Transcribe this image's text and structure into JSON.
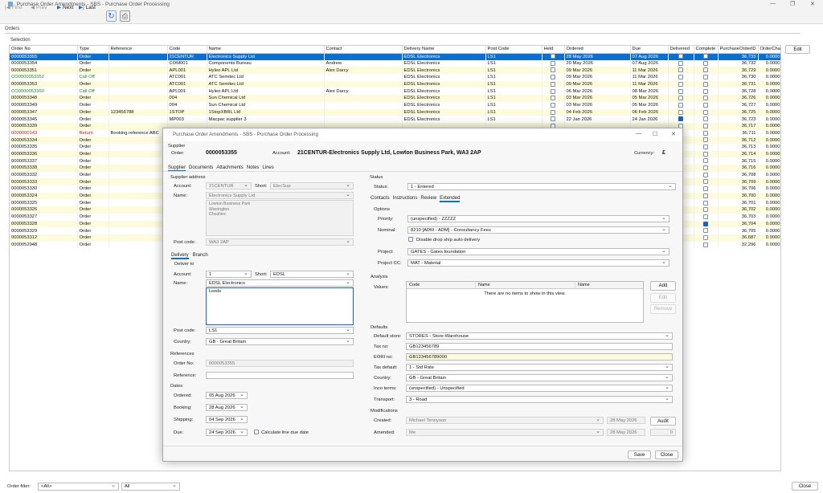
{
  "window": {
    "title": "Purchase Order Amendments - SBS - Purchase Order Processing"
  },
  "toolbar": {
    "first": "First",
    "prev": "Prev",
    "next": "Next",
    "last": "Last"
  },
  "sections": {
    "orders": "Orders",
    "selection": "Selection"
  },
  "grid": {
    "columns": [
      "Order No",
      "Type",
      "Reference",
      "Code",
      "Name",
      "Contact",
      "Delivery Name",
      "Post Code",
      "Held",
      "Ordered",
      "Due",
      "Delivered",
      "Complete",
      "PurchaseOrderID",
      "OrderCha"
    ],
    "rows": [
      {
        "no": "0000053355",
        "type": "Order",
        "ref": "",
        "code": "21CENTUR",
        "name": "Electronics Supply Ltd",
        "contact": "",
        "deliv": "EDSL Electronics",
        "pc": "LS1",
        "ordered": "28 May 2026",
        "due": "07 Aug 2026",
        "delivered": false,
        "complete": false,
        "id": "36,733",
        "cha": "0.0000",
        "style": "sel"
      },
      {
        "no": "0000053354",
        "type": "Order",
        "ref": "",
        "code": "COM001",
        "name": "Components Bureau",
        "contact": "Andrew",
        "deliv": "EDSL Electronics",
        "pc": "LS1",
        "ordered": "20 May 2026",
        "due": "07 Aug 2026",
        "delivered": false,
        "complete": false,
        "id": "36,732",
        "cha": "0.0000",
        "style": ""
      },
      {
        "no": "0000053351",
        "type": "Order",
        "ref": "",
        "code": "APL001",
        "name": "Hyleo APL Ltd",
        "contact": "Alex Darcy",
        "deliv": "EDSL Electronics",
        "pc": "LS1",
        "ordered": "09 Mar 2026",
        "due": "11 Mar 2026",
        "delivered": false,
        "complete": false,
        "id": "36,729",
        "cha": "0.0000",
        "style": "alt"
      },
      {
        "no": "CO0000053352",
        "type": "Call Off",
        "ref": "",
        "code": "ATC001",
        "name": "ATC Semitec Ltd",
        "contact": "",
        "deliv": "EDSL Electronics",
        "pc": "LS1",
        "ordered": "09 Mar 2026",
        "due": "11 Mar 2026",
        "delivered": false,
        "complete": false,
        "id": "36,730",
        "cha": "0.0000",
        "style": "green"
      },
      {
        "no": "0000053353",
        "type": "Order",
        "ref": "",
        "code": "ATC001",
        "name": "ATC Semitec Ltd",
        "contact": "",
        "deliv": "EDSL Electronics",
        "pc": "LS1",
        "ordered": "09 Mar 2026",
        "due": "11 Mar 2026",
        "delivered": false,
        "complete": false,
        "id": "36,731",
        "cha": "0.0000",
        "style": "alt"
      },
      {
        "no": "CO0000053350",
        "type": "Call Off",
        "ref": "",
        "code": "APL001",
        "name": "Hyleo APL Ltd",
        "contact": "Alex Darcy",
        "deliv": "EDSL Electronics",
        "pc": "LS1",
        "ordered": "06 Mar 2026",
        "due": "08 Mar 2026",
        "delivered": false,
        "complete": false,
        "id": "36,728",
        "cha": "0.0000",
        "style": "green"
      },
      {
        "no": "0000053348",
        "type": "Order",
        "ref": "",
        "code": "004",
        "name": "Sun Chemical Ltd",
        "contact": "",
        "deliv": "EDSL Electronics",
        "pc": "LS1",
        "ordered": "03 Mar 2026",
        "due": "05 Mar 2026",
        "delivered": false,
        "complete": false,
        "id": "36,726",
        "cha": "0.0000",
        "style": "alt"
      },
      {
        "no": "0000053349",
        "type": "Order",
        "ref": "",
        "code": "004",
        "name": "Sun Chemical Ltd",
        "contact": "",
        "deliv": "EDSL Electronics",
        "pc": "LS1",
        "ordered": "03 Mar 2026",
        "due": "05 Mar 2026",
        "delivered": false,
        "complete": false,
        "id": "36,727",
        "cha": "0.0000",
        "style": ""
      },
      {
        "no": "0000053347",
        "type": "Order",
        "ref": "123456788",
        "code": "1STOP",
        "name": "1StopXBRL Ltd",
        "contact": "",
        "deliv": "EDSL Electronics",
        "pc": "LS1",
        "ordered": "04 Feb 2026",
        "due": "06 Feb 2026",
        "delivered": false,
        "complete": false,
        "id": "36,725",
        "cha": "0.0000",
        "style": "alt"
      },
      {
        "no": "0000053345",
        "type": "Order",
        "ref": "",
        "code": "MP003",
        "name": "Macpac supplier 3",
        "contact": "",
        "deliv": "EDSL Electronics",
        "pc": "LS1",
        "ordered": "22 Jan 2026",
        "due": "24 Jan 2026",
        "delivered": true,
        "complete": false,
        "id": "36,723",
        "cha": "0.0000",
        "style": ""
      },
      {
        "no": "0000053339",
        "type": "Order",
        "ref": "",
        "code": "",
        "name": "",
        "contact": "",
        "deliv": "",
        "pc": "",
        "ordered": "",
        "due": "",
        "delivered": false,
        "complete": false,
        "id": "36,717",
        "cha": "0.0000",
        "style": "alt"
      },
      {
        "no": "0000000143",
        "type": "Return",
        "ref": "Booking reference ABC",
        "code": "",
        "name": "",
        "contact": "",
        "deliv": "",
        "pc": "",
        "ordered": "",
        "due": "",
        "delivered": false,
        "complete": false,
        "id": "36,711",
        "cha": "0.0000",
        "style": "red"
      },
      {
        "no": "0000053334",
        "type": "Order",
        "ref": "",
        "code": "",
        "name": "",
        "contact": "",
        "deliv": "",
        "pc": "",
        "ordered": "",
        "due": "",
        "delivered": false,
        "complete": false,
        "id": "36,712",
        "cha": "0.0000",
        "style": "alt"
      },
      {
        "no": "0000053335",
        "type": "Order",
        "ref": "",
        "code": "",
        "name": "",
        "contact": "",
        "deliv": "",
        "pc": "",
        "ordered": "",
        "due": "",
        "delivered": false,
        "complete": false,
        "id": "36,713",
        "cha": "0.0000",
        "style": ""
      },
      {
        "no": "0000053336",
        "type": "Order",
        "ref": "",
        "code": "",
        "name": "",
        "contact": "",
        "deliv": "",
        "pc": "",
        "ordered": "",
        "due": "",
        "delivered": false,
        "complete": false,
        "id": "36,714",
        "cha": "0.0000",
        "style": "alt"
      },
      {
        "no": "0000053337",
        "type": "Order",
        "ref": "",
        "code": "",
        "name": "",
        "contact": "",
        "deliv": "",
        "pc": "",
        "ordered": "",
        "due": "",
        "delivered": false,
        "complete": false,
        "id": "36,715",
        "cha": "0.0000",
        "style": ""
      },
      {
        "no": "0000053338",
        "type": "Order",
        "ref": "",
        "code": "",
        "name": "",
        "contact": "",
        "deliv": "",
        "pc": "",
        "ordered": "",
        "due": "",
        "delivered": false,
        "complete": false,
        "id": "36,716",
        "cha": "0.0000",
        "style": "alt"
      },
      {
        "no": "0000053332",
        "type": "Order",
        "ref": "",
        "code": "",
        "name": "",
        "contact": "",
        "deliv": "",
        "pc": "",
        "ordered": "",
        "due": "",
        "delivered": false,
        "complete": false,
        "id": "36,708",
        "cha": "0.0000",
        "style": ""
      },
      {
        "no": "0000053333",
        "type": "Order",
        "ref": "",
        "code": "",
        "name": "",
        "contact": "",
        "deliv": "",
        "pc": "",
        "ordered": "",
        "due": "",
        "delivered": false,
        "complete": false,
        "id": "36,709",
        "cha": "0.0000",
        "style": "alt"
      },
      {
        "no": "0000053330",
        "type": "Order",
        "ref": "",
        "code": "",
        "name": "",
        "contact": "",
        "deliv": "",
        "pc": "",
        "ordered": "",
        "due": "",
        "delivered": false,
        "complete": false,
        "id": "36,706",
        "cha": "0.0000",
        "style": ""
      },
      {
        "no": "0000053324",
        "type": "Order",
        "ref": "",
        "code": "",
        "name": "",
        "contact": "",
        "deliv": "",
        "pc": "",
        "ordered": "",
        "due": "",
        "delivered": false,
        "complete": false,
        "id": "36,700",
        "cha": "0.0000",
        "style": "alt"
      },
      {
        "no": "0000053325",
        "type": "Order",
        "ref": "",
        "code": "",
        "name": "",
        "contact": "",
        "deliv": "",
        "pc": "",
        "ordered": "",
        "due": "",
        "delivered": false,
        "complete": false,
        "id": "36,701",
        "cha": "0.0000",
        "style": ""
      },
      {
        "no": "0000053326",
        "type": "Order",
        "ref": "",
        "code": "",
        "name": "",
        "contact": "",
        "deliv": "",
        "pc": "",
        "ordered": "",
        "due": "",
        "delivered": false,
        "complete": false,
        "id": "36,702",
        "cha": "0.0000",
        "style": "alt"
      },
      {
        "no": "0000053327",
        "type": "Order",
        "ref": "",
        "code": "",
        "name": "",
        "contact": "",
        "deliv": "",
        "pc": "",
        "ordered": "",
        "due": "",
        "delivered": false,
        "complete": false,
        "id": "36,703",
        "cha": "0.0000",
        "style": ""
      },
      {
        "no": "0000053328",
        "type": "Order",
        "ref": "",
        "code": "",
        "name": "",
        "contact": "",
        "deliv": "",
        "pc": "",
        "ordered": "",
        "due": "",
        "delivered": false,
        "complete": true,
        "id": "36,704",
        "cha": "0.0000",
        "style": "alt"
      },
      {
        "no": "0000053329",
        "type": "Order",
        "ref": "",
        "code": "",
        "name": "",
        "contact": "",
        "deliv": "",
        "pc": "",
        "ordered": "",
        "due": "",
        "delivered": false,
        "complete": false,
        "id": "36,705",
        "cha": "0.0000",
        "style": ""
      },
      {
        "no": "0000053312",
        "type": "Order",
        "ref": "",
        "code": "",
        "name": "",
        "contact": "",
        "deliv": "",
        "pc": "",
        "ordered": "",
        "due": "",
        "delivered": false,
        "complete": false,
        "id": "36,687",
        "cha": "0.0000",
        "style": "alt"
      },
      {
        "no": "0000052948",
        "type": "Order",
        "ref": "",
        "code": "",
        "name": "",
        "contact": "",
        "deliv": "",
        "pc": "",
        "ordered": "",
        "due": "",
        "delivered": false,
        "complete": false,
        "id": "32,296",
        "cha": "0.0000",
        "style": ""
      }
    ]
  },
  "side": {
    "edit": "Edit",
    "close": "Close"
  },
  "filter": {
    "label": "Order filter:",
    "value1": "<All>",
    "value2": "All"
  },
  "dialog": {
    "title": "Purchase Order Amendments - SBS - Purchase Order Processing",
    "supplier_label": "Supplier",
    "order_label": "Order:",
    "order_no": "0000053355",
    "account_label": "Account:",
    "account_value": "21CENTUR-Electronics Supply Ltd, Lowton Business Park, WA3 2AP",
    "currency_label": "Currency:",
    "currency_value": "£",
    "tabs": [
      "Supplier",
      "Documents",
      "Attachments",
      "Notes",
      "Lines"
    ],
    "supplier_address": {
      "heading": "Supplier address",
      "account_label": "Account:",
      "account": "21CENTUR",
      "short_label": "Short:",
      "short": "ElecSup",
      "name_label": "Name:",
      "name": "Electronics Supply Ltd",
      "address": [
        "Lowton Business Park",
        "Warrington",
        "Cheshire"
      ],
      "postcode_label": "Post code:",
      "postcode": "WA3 2AP"
    },
    "delivery_tabs": [
      "Delivery",
      "Branch"
    ],
    "deliver_to": {
      "heading": "Deliver to",
      "account_label": "Account:",
      "account": "1",
      "short_label": "Short:",
      "short": "EDSL",
      "name_label": "Name:",
      "name": "EDSL Electronics",
      "address": [
        "Leeds"
      ],
      "postcode_label": "Post code:",
      "postcode": "LS1",
      "country_label": "Country:",
      "country": "GB - Great Britain"
    },
    "references": {
      "heading": "References",
      "orderno_label": "Order No:",
      "orderno": "0000053355",
      "reference_label": "Reference:",
      "reference": ""
    },
    "dates": {
      "heading": "Dates",
      "ordered_label": "Ordered:",
      "ordered": "05 Aug 2026",
      "booking_label": "Booking:",
      "booking": "28 Aug 2026",
      "shipping_label": "Shipping:",
      "shipping": "04 Sep 2026",
      "due_label": "Due:",
      "due": "24 Sep 2026",
      "calc_label": "Calculate line due date"
    },
    "status": {
      "heading": "Status",
      "label": "Status:",
      "value": "1 - Entered"
    },
    "right_tabs": [
      "Contacts",
      "Instructions",
      "Review",
      "Extended"
    ],
    "options": {
      "heading": "Options",
      "priority_label": "Priority:",
      "priority": "(unspecified) - ZZZZZ",
      "nominal_label": "Nominal:",
      "nominal": "8210 [ADM - ADM] - Consultancy Fees",
      "dropship_label": "Disable drop ship auto delivery",
      "project_label": "Project:",
      "project": "GATES - Gates foundation",
      "projectcc_label": "Project CC:",
      "projectcc": "MAT - Material"
    },
    "analysis": {
      "heading": "Analysis",
      "values_label": "Values:",
      "cols": [
        "Code",
        "Name",
        "Name"
      ],
      "empty": "There are no items to show in this view.",
      "add": "Add",
      "edit": "Edit",
      "remove": "Remove"
    },
    "defaults": {
      "heading": "Defaults",
      "store_label": "Default store:",
      "store": "STORES - Store-Warehouse",
      "taxno_label": "Tax no:",
      "taxno": "GB123456789",
      "eori_label": "EORI no:",
      "eori": "GB123456789000",
      "taxdef_label": "Tax default:",
      "taxdef": "1 - Std Rate",
      "country_label": "Country:",
      "country": "GB - Great Britain",
      "inco_label": "Inco terms:",
      "inco": "(unspecified) - Unspecified",
      "transport_label": "Transport:",
      "transport": "3 - Road"
    },
    "modifications": {
      "heading": "Modifications",
      "created_label": "Created:",
      "created_by": "Michael Tennyson",
      "created_on": "28 May 2026",
      "amended_label": "Amended:",
      "amended_by": "Me",
      "amended_on": "28 May 2026",
      "audit": "Audit",
      "count": "0"
    },
    "save": "Save",
    "close": "Close"
  }
}
